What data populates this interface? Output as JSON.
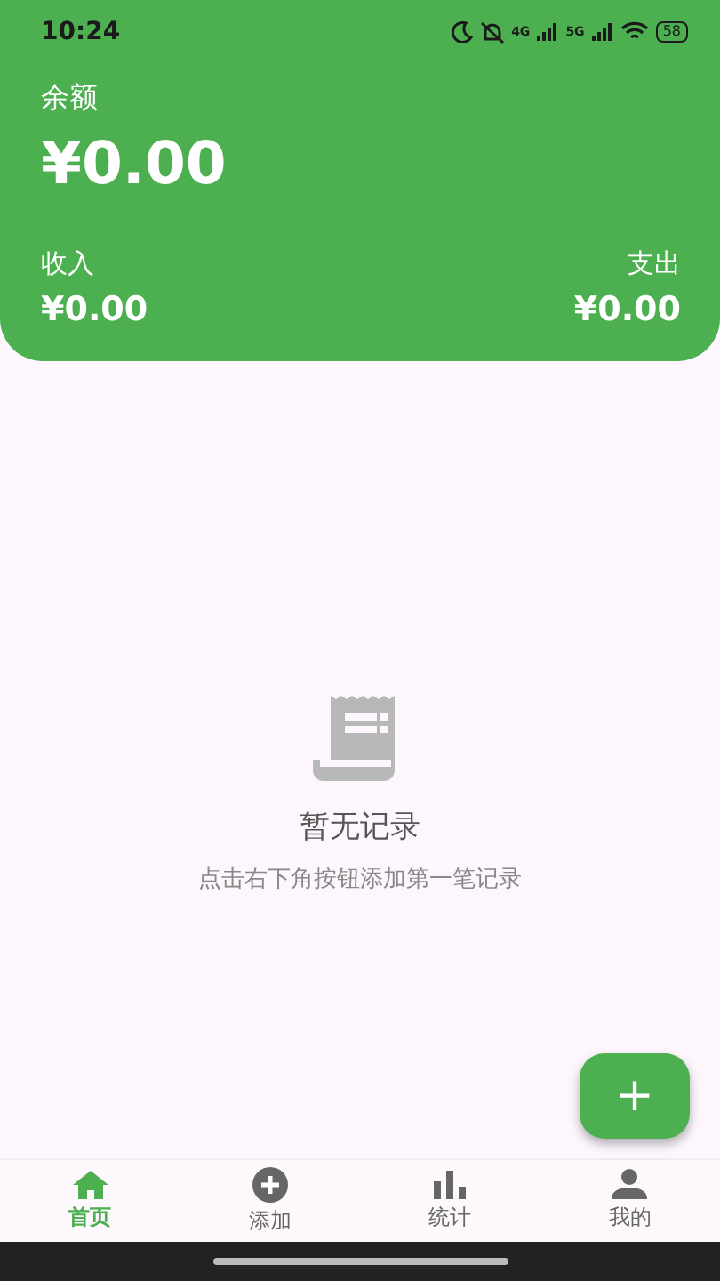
{
  "status_bar": {
    "time": "10:24",
    "signal_1": "4G",
    "signal_2": "5G",
    "battery": "58"
  },
  "summary": {
    "balance_label": "余额",
    "balance": "¥0.00",
    "income_label": "收入",
    "income": "¥0.00",
    "expense_label": "支出",
    "expense": "¥0.00"
  },
  "empty_state": {
    "title": "暂无记录",
    "hint": "点击右下角按钮添加第一笔记录"
  },
  "fab": {
    "label": "+"
  },
  "tabs": [
    {
      "kind": "home",
      "label": "首页",
      "selected": true
    },
    {
      "kind": "add",
      "label": "添加",
      "selected": false
    },
    {
      "kind": "stats",
      "label": "统计",
      "selected": false
    },
    {
      "kind": "profile",
      "label": "我的",
      "selected": false
    }
  ]
}
